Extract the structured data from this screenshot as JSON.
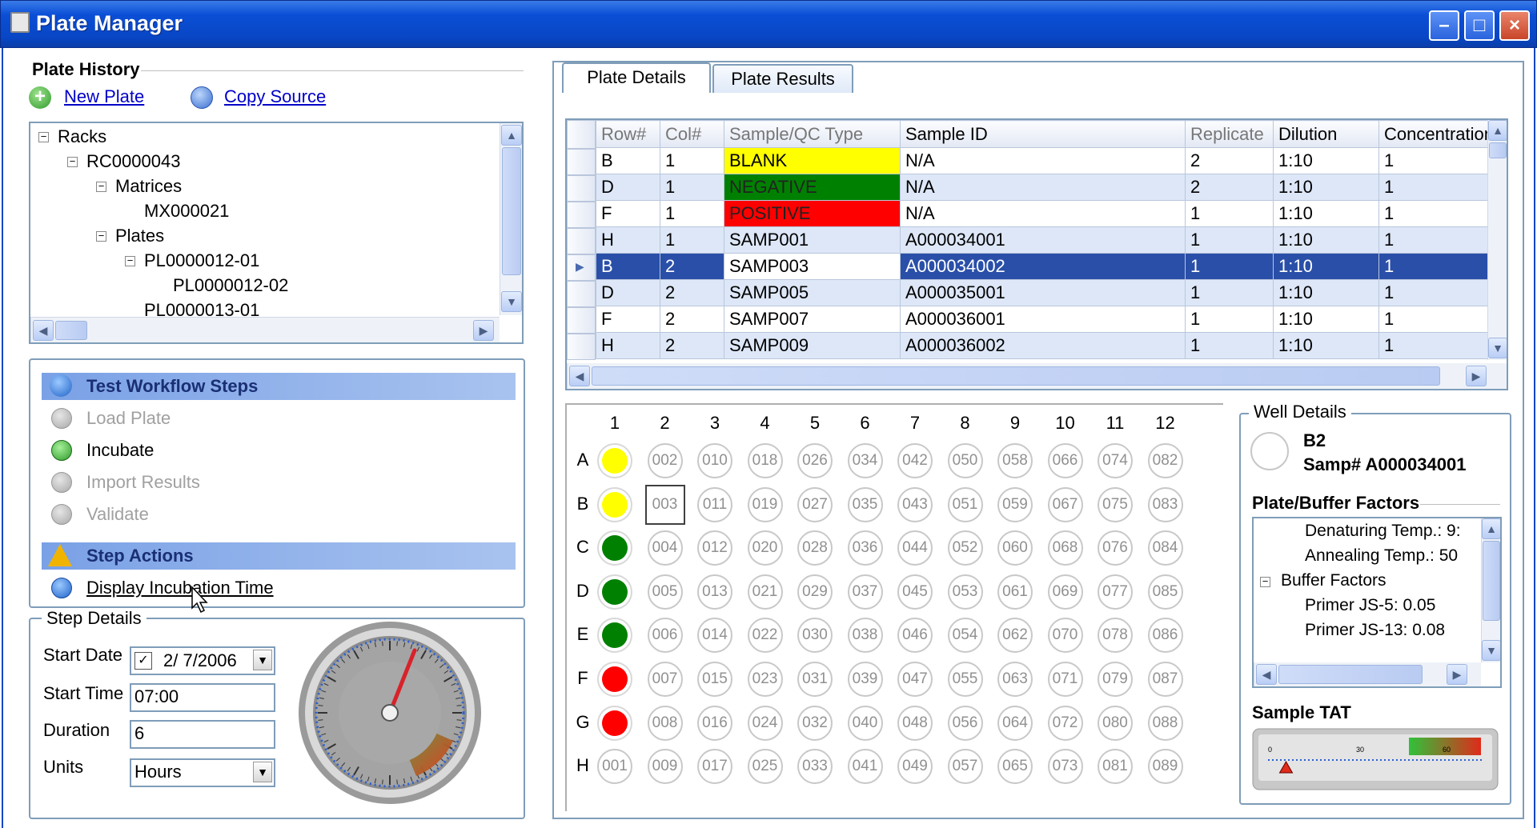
{
  "window": {
    "title": "Plate Manager",
    "min": "–",
    "max": "□",
    "close": "×"
  },
  "history": {
    "title": "Plate History",
    "new_plate": "New Plate",
    "copy_source": "Copy Source",
    "tree": [
      {
        "label": "Racks",
        "level": 0,
        "expander": "−"
      },
      {
        "label": "RC0000043",
        "level": 1,
        "expander": "−"
      },
      {
        "label": "Matrices",
        "level": 2,
        "expander": "−"
      },
      {
        "label": "MX000021",
        "level": 3,
        "expander": ""
      },
      {
        "label": "Plates",
        "level": 2,
        "expander": "−"
      },
      {
        "label": "PL0000012-01",
        "level": 3,
        "expander": "−"
      },
      {
        "label": "PL0000012-02",
        "level": 4,
        "expander": ""
      },
      {
        "label": "PL0000013-01",
        "level": 3,
        "expander": ""
      }
    ]
  },
  "workflow": {
    "title": "Test Workflow Steps",
    "steps": [
      {
        "label": "Load Plate",
        "enabled": false
      },
      {
        "label": "Incubate",
        "enabled": true
      },
      {
        "label": "Import Results",
        "enabled": false
      },
      {
        "label": "Validate",
        "enabled": false
      }
    ],
    "actions_title": "Step Actions",
    "action": "Display Incubation Time"
  },
  "step_details": {
    "title": "Step Details",
    "start_date_label": "Start Date",
    "start_date": "2/ 7/2006",
    "start_time_label": "Start Time",
    "start_time": "07:00",
    "duration_label": "Duration",
    "duration": "6",
    "units_label": "Units",
    "units": "Hours"
  },
  "gauge": {
    "value_hours": 6,
    "max": 12
  },
  "tabs": [
    {
      "label": "Plate Details"
    },
    {
      "label": "Plate Results"
    }
  ],
  "grid": {
    "headers": [
      "Row#",
      "Col#",
      "Sample/QC Type",
      "Sample ID",
      "Replicate",
      "Dilution",
      "Concentration"
    ],
    "rows": [
      [
        "B",
        "1",
        "BLANK",
        "N/A",
        "2",
        "1:10",
        "1"
      ],
      [
        "D",
        "1",
        "NEGATIVE",
        "N/A",
        "2",
        "1:10",
        "1"
      ],
      [
        "F",
        "1",
        "POSITIVE",
        "N/A",
        "1",
        "1:10",
        "1"
      ],
      [
        "H",
        "1",
        "SAMP001",
        "A000034001",
        "1",
        "1:10",
        "1"
      ],
      [
        "B",
        "2",
        "SAMP003",
        "A000034002",
        "1",
        "1:10",
        "1"
      ],
      [
        "D",
        "2",
        "SAMP005",
        "A000035001",
        "1",
        "1:10",
        "1"
      ],
      [
        "F",
        "2",
        "SAMP007",
        "A000036001",
        "1",
        "1:10",
        "1"
      ],
      [
        "H",
        "2",
        "SAMP009",
        "A000036002",
        "1",
        "1:10",
        "1"
      ]
    ],
    "type_colors": {
      "BLANK": "#ffff00",
      "NEGATIVE": "#008000",
      "POSITIVE": "#ff0000"
    },
    "selected_row": 4
  },
  "plate": {
    "cols": [
      "1",
      "2",
      "3",
      "4",
      "5",
      "6",
      "7",
      "8",
      "9",
      "10",
      "11",
      "12"
    ],
    "rows": [
      "A",
      "B",
      "C",
      "D",
      "E",
      "F",
      "G",
      "H"
    ],
    "col1_colors": [
      "#ffff00",
      "#ffff00",
      "#008000",
      "#008000",
      "#008000",
      "#ff0000",
      "#ff0000",
      ""
    ],
    "selected_well": "B2"
  },
  "well_details": {
    "title": "Well Details",
    "well": "B2",
    "samp": "Samp# A000034001",
    "factors_title": "Plate/Buffer Factors",
    "factors": [
      {
        "label": "Denaturing Temp.: 9:",
        "level": 2,
        "expander": ""
      },
      {
        "label": "Annealing Temp.: 50",
        "level": 2,
        "expander": ""
      },
      {
        "label": "Buffer Factors",
        "level": 1,
        "expander": "−"
      },
      {
        "label": "Primer JS-5: 0.05",
        "level": 2,
        "expander": ""
      },
      {
        "label": "Primer JS-13: 0.08",
        "level": 2,
        "expander": ""
      }
    ],
    "tat_title": "Sample TAT",
    "tat_scale": [
      "0",
      "30",
      "60"
    ],
    "tat_value": 5
  }
}
